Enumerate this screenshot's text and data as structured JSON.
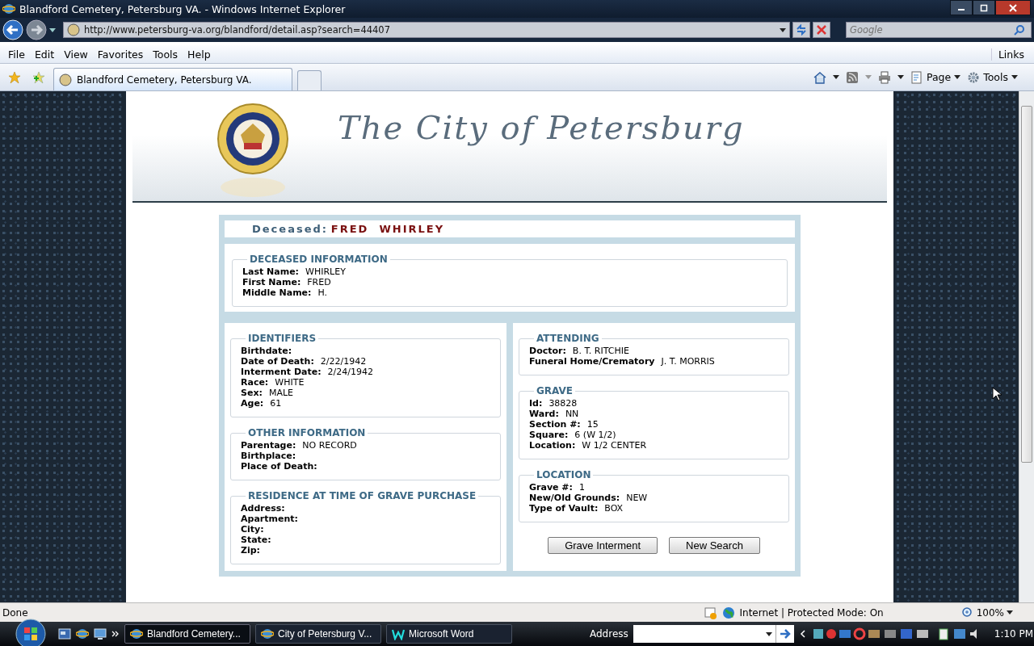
{
  "window": {
    "title": "Blandford Cemetery, Petersburg VA. - Windows Internet Explorer"
  },
  "address_bar": {
    "url": "http://www.petersburg-va.org/blandford/detail.asp?search=44407"
  },
  "search": {
    "placeholder": "Google"
  },
  "menu": [
    "File",
    "Edit",
    "View",
    "Favorites",
    "Tools",
    "Help"
  ],
  "links": "Links",
  "tabs": [
    {
      "label": "Blandford Cemetery, Petersburg VA.",
      "selected": true
    }
  ],
  "command_bar": [
    "Page",
    "Tools"
  ],
  "page": {
    "header_title": "The City of Petersburg",
    "deceased_label": "Deceased:",
    "deceased_name": "FRED  WHIRLEY",
    "deceased_information": {
      "title": "DECEASED INFORMATION",
      "fields": [
        {
          "label": "Last Name:",
          "value": "WHIRLEY"
        },
        {
          "label": "First Name:",
          "value": "FRED"
        },
        {
          "label": "Middle Name:",
          "value": "H."
        }
      ]
    },
    "left_sections": [
      {
        "title": "IDENTIFIERS",
        "fields": [
          {
            "label": "Birthdate:"
          },
          {
            "label": "Date of Death:",
            "value": "2/22/1942"
          },
          {
            "label": "Interment Date:",
            "value": "2/24/1942"
          },
          {
            "label": "Race:",
            "value": "WHITE"
          },
          {
            "label": "Sex:",
            "value": "MALE"
          },
          {
            "label": "Age:",
            "value": "61"
          }
        ]
      },
      {
        "title": "OTHER INFORMATION",
        "fields": [
          {
            "label": "Parentage:",
            "value": "NO RECORD"
          },
          {
            "label": "Birthplace:"
          },
          {
            "label": "Place of Death:"
          }
        ]
      },
      {
        "title": "RESIDENCE AT TIME OF GRAVE PURCHASE",
        "fields": [
          {
            "label": "Address:"
          },
          {
            "label": "Apartment:"
          },
          {
            "label": "City:"
          },
          {
            "label": "State:"
          },
          {
            "label": "Zip:"
          }
        ]
      }
    ],
    "right_sections": [
      {
        "title": "ATTENDING",
        "fields": [
          {
            "label": "Doctor:",
            "value": "B. T. RITCHIE"
          },
          {
            "label": "Funeral Home/Crematory",
            "value": "J. T. MORRIS"
          }
        ]
      },
      {
        "title": "GRAVE",
        "fields": [
          {
            "label": "Id:",
            "value": "38828"
          },
          {
            "label": "Ward:",
            "value": "NN"
          },
          {
            "label": "Section #:",
            "value": "15"
          },
          {
            "label": "Square:",
            "value": "6 (W 1/2)"
          },
          {
            "label": "Location:",
            "value": "W 1/2 CENTER"
          }
        ]
      },
      {
        "title": "LOCATION",
        "fields": [
          {
            "label": "Grave #:",
            "value": "1"
          },
          {
            "label": "New/Old Grounds:",
            "value": "NEW"
          },
          {
            "label": "Type of Vault:",
            "value": "BOX"
          }
        ]
      }
    ],
    "buttons": [
      "Grave Interment",
      "New Search"
    ]
  },
  "status_bar": {
    "text": "Done",
    "zone": "Internet | Protected Mode: On",
    "zoom": "100%"
  },
  "taskbar": {
    "buttons": [
      {
        "label": "Blandford Cemetery...",
        "kind": "ie",
        "selected": true
      },
      {
        "label": "City of Petersburg V...",
        "kind": "ie",
        "selected": false
      },
      {
        "label": "Microsoft Word",
        "kind": "word",
        "selected": false
      }
    ],
    "address_label": "Address",
    "clock": "1:10 PM"
  }
}
